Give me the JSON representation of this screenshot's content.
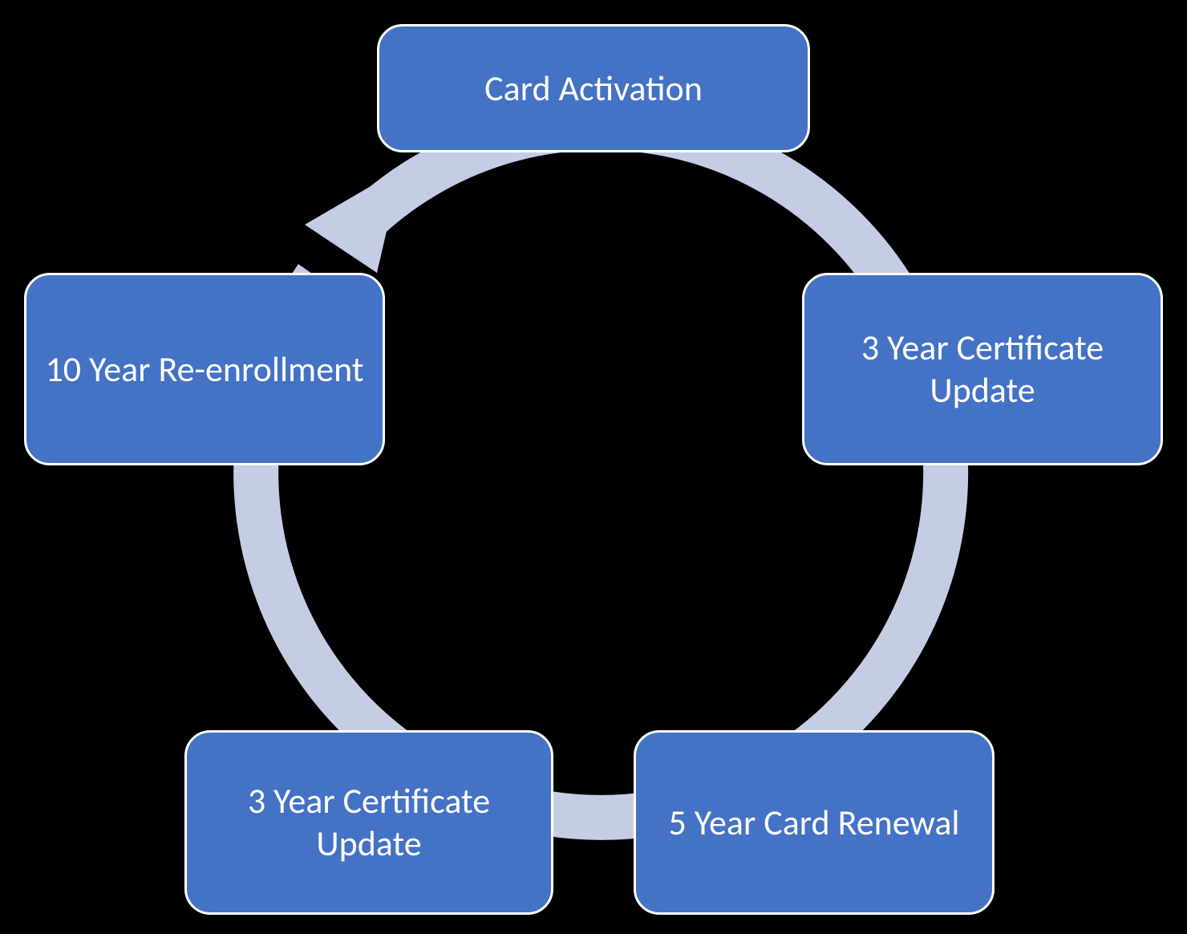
{
  "diagram": {
    "cycle_color": "#C5CDE5",
    "node_fill": "#4472C4",
    "node_border": "#FFFFFF",
    "nodes": [
      {
        "id": "card-activation",
        "label": "Card Activation"
      },
      {
        "id": "cert-update-3yr-a",
        "label": "3 Year Certificate Update"
      },
      {
        "id": "card-renewal-5yr",
        "label": "5 Year Card Renewal"
      },
      {
        "id": "cert-update-3yr-b",
        "label": "3 Year Certificate Update"
      },
      {
        "id": "re-enrollment-10yr",
        "label": "10 Year Re-enrollment"
      }
    ]
  }
}
